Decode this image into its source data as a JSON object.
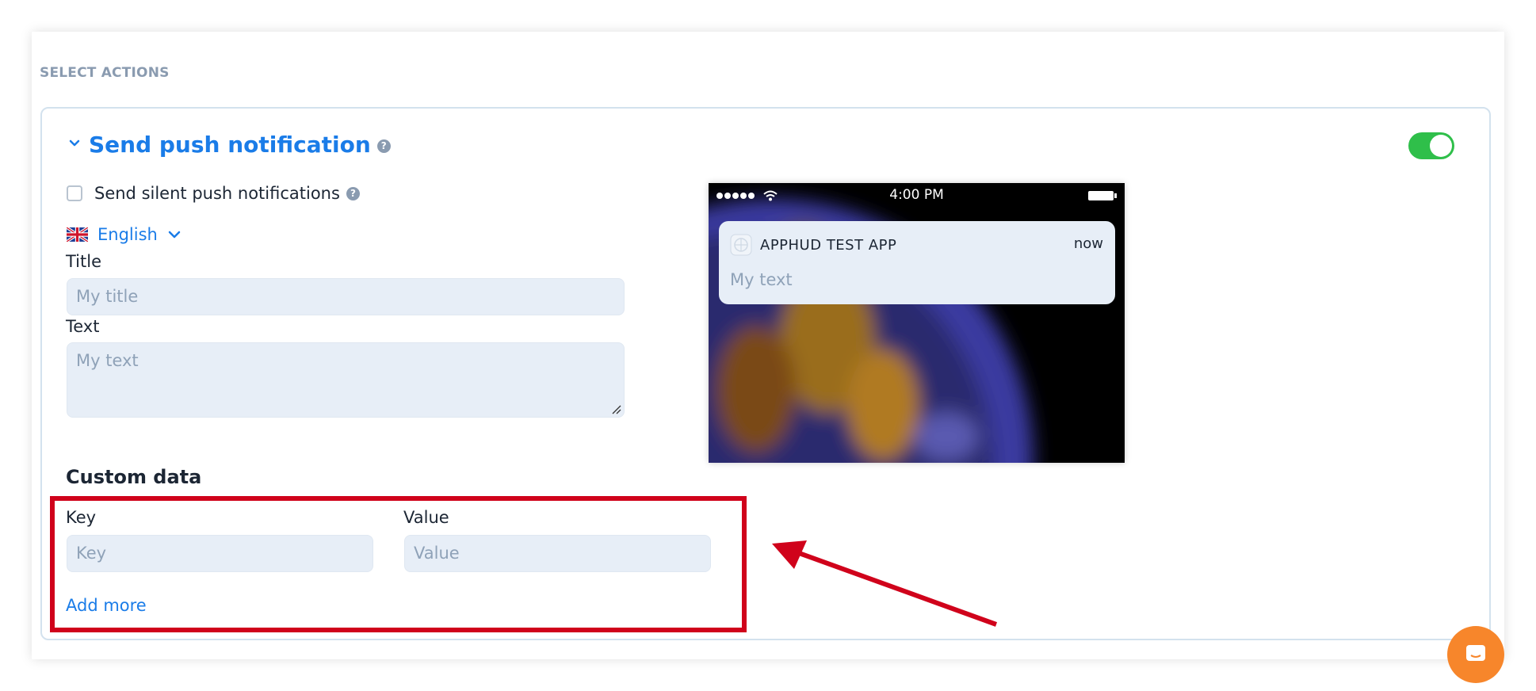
{
  "section": {
    "label": "SELECT ACTIONS"
  },
  "action": {
    "title": "Send push notification",
    "enabled": true
  },
  "silent_push": {
    "label": "Send silent push notifications",
    "checked": false
  },
  "language": {
    "selected": "English"
  },
  "title_field": {
    "label": "Title",
    "placeholder": "My title"
  },
  "text_field": {
    "label": "Text",
    "placeholder": "My text"
  },
  "preview": {
    "time": "4:00 PM",
    "app_name": "APPHUD TEST APP",
    "notif_time": "now",
    "notif_text": "My text"
  },
  "custom_data": {
    "title": "Custom data",
    "key_label": "Key",
    "key_placeholder": "Key",
    "value_label": "Value",
    "value_placeholder": "Value",
    "add_more": "Add more"
  },
  "icons": {
    "help": "question-mark-icon",
    "chevron": "chevron-down-icon",
    "flag": "uk-flag-icon",
    "chat": "chat-icon"
  },
  "colors": {
    "accent": "#1a7ce8",
    "toggle_on": "#2fbf4a",
    "annotation": "#d0021b",
    "chat": "#f7862b"
  }
}
